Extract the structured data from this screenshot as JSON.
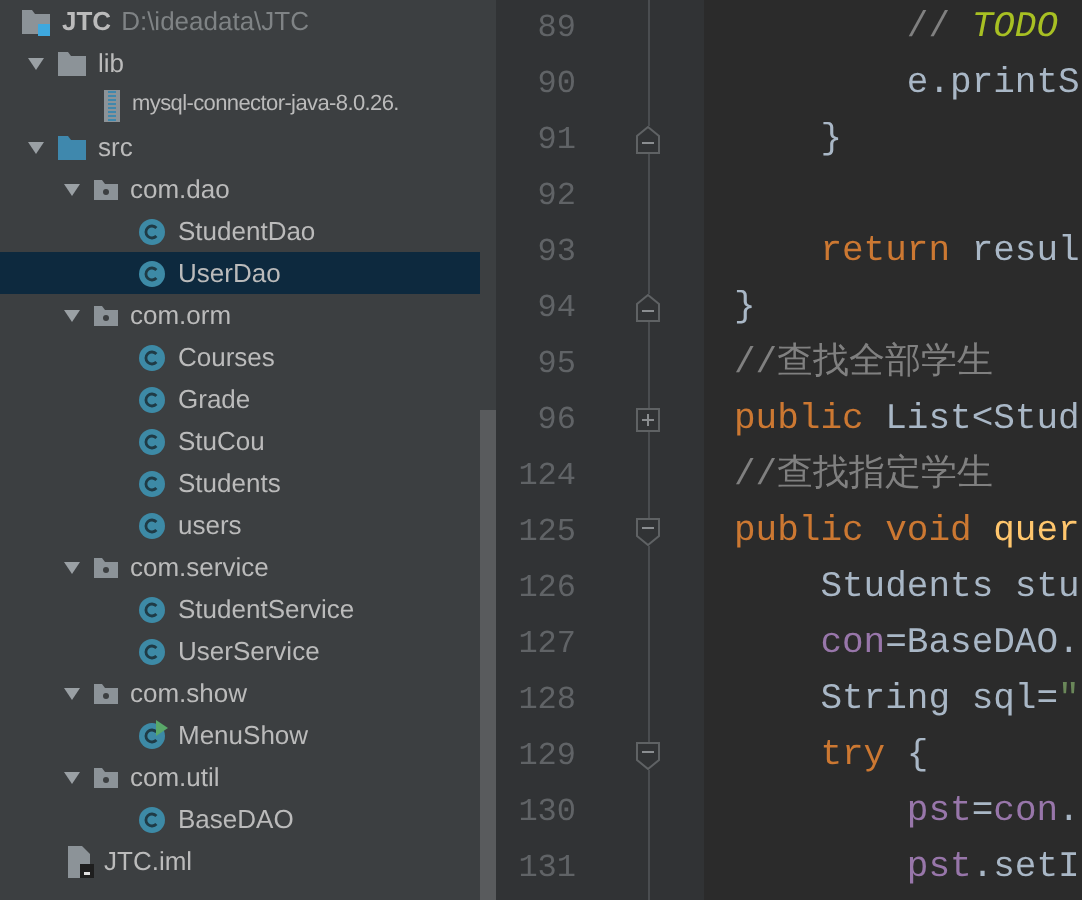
{
  "project_tree": [
    {
      "kind": "module",
      "label": "JTC",
      "path": "D:\\ideadata\\JTC",
      "selected": false,
      "children": [
        {
          "kind": "folder",
          "label": "lib",
          "expanded": true,
          "selected": false,
          "children": [
            {
              "kind": "jar",
              "label": "mysql-connector-java-8.0.26.",
              "selected": false
            }
          ]
        },
        {
          "kind": "source",
          "label": "src",
          "expanded": true,
          "selected": false,
          "children": [
            {
              "kind": "package",
              "label": "com.dao",
              "expanded": true,
              "selected": false,
              "children": [
                {
                  "kind": "class",
                  "label": "StudentDao",
                  "selected": false
                },
                {
                  "kind": "class",
                  "label": "UserDao",
                  "selected": true
                }
              ]
            },
            {
              "kind": "package",
              "label": "com.orm",
              "expanded": true,
              "selected": false,
              "children": [
                {
                  "kind": "class",
                  "label": "Courses",
                  "selected": false
                },
                {
                  "kind": "class",
                  "label": "Grade",
                  "selected": false
                },
                {
                  "kind": "class",
                  "label": "StuCou",
                  "selected": false
                },
                {
                  "kind": "class",
                  "label": "Students",
                  "selected": false
                },
                {
                  "kind": "class",
                  "label": "users",
                  "selected": false
                }
              ]
            },
            {
              "kind": "package",
              "label": "com.service",
              "expanded": true,
              "selected": false,
              "children": [
                {
                  "kind": "class",
                  "label": "StudentService",
                  "selected": false
                },
                {
                  "kind": "class",
                  "label": "UserService",
                  "selected": false
                }
              ]
            },
            {
              "kind": "package",
              "label": "com.show",
              "expanded": true,
              "selected": false,
              "children": [
                {
                  "kind": "runnable",
                  "label": "MenuShow",
                  "selected": false
                }
              ]
            },
            {
              "kind": "package",
              "label": "com.util",
              "expanded": true,
              "selected": false,
              "children": [
                {
                  "kind": "class",
                  "label": "BaseDAO",
                  "selected": false
                }
              ]
            }
          ]
        },
        {
          "kind": "file",
          "label": "JTC.iml",
          "selected": false
        }
      ]
    }
  ],
  "editor": {
    "lines": [
      {
        "number": "89",
        "kind": "plain",
        "tokens": [
          {
            "kind": "comment",
            "text": "        // "
          },
          {
            "kind": "todo",
            "text": "TODO"
          }
        ]
      },
      {
        "number": "90",
        "kind": "plain",
        "tokens": [
          {
            "kind": "plain",
            "text": "        e.printS"
          }
        ]
      },
      {
        "number": "91",
        "kind": "closer",
        "tokens": [
          {
            "kind": "plain",
            "text": "    }"
          }
        ]
      },
      {
        "number": "92",
        "kind": "plain"
      },
      {
        "number": "93",
        "kind": "plain",
        "tokens": [
          {
            "kind": "keyword",
            "text": "    return "
          },
          {
            "kind": "plain",
            "text": "resul"
          }
        ]
      },
      {
        "number": "94",
        "kind": "closer",
        "tokens": [
          {
            "kind": "plain",
            "text": "}"
          }
        ]
      },
      {
        "number": "95",
        "kind": "plain",
        "tokens": [
          {
            "kind": "comment",
            "text": "//查找全部学生"
          }
        ]
      },
      {
        "number": "96",
        "kind": "collapsed",
        "tokens": [
          {
            "kind": "keyword",
            "text": "public "
          },
          {
            "kind": "plain",
            "text": "List<Stud"
          }
        ]
      },
      {
        "number": "124",
        "kind": "plain",
        "tokens": [
          {
            "kind": "comment",
            "text": "//查找指定学生"
          }
        ]
      },
      {
        "number": "125",
        "kind": "opener",
        "tokens": [
          {
            "kind": "keyword",
            "text": "public void "
          },
          {
            "kind": "method",
            "text": "quer"
          }
        ]
      },
      {
        "number": "126",
        "kind": "plain",
        "tokens": [
          {
            "kind": "plain",
            "text": "    Students stu"
          }
        ]
      },
      {
        "number": "127",
        "kind": "plain",
        "tokens": [
          {
            "kind": "field",
            "text": "    con"
          },
          {
            "kind": "plain",
            "text": "=BaseDAO."
          }
        ]
      },
      {
        "number": "128",
        "kind": "plain",
        "tokens": [
          {
            "kind": "plain",
            "text": "    String sql="
          },
          {
            "kind": "string",
            "text": "\""
          }
        ]
      },
      {
        "number": "129",
        "kind": "opener",
        "tokens": [
          {
            "kind": "keyword",
            "text": "    try "
          },
          {
            "kind": "plain",
            "text": "{"
          }
        ]
      },
      {
        "number": "130",
        "kind": "plain",
        "tokens": [
          {
            "kind": "field",
            "text": "        pst"
          },
          {
            "kind": "plain",
            "text": "="
          },
          {
            "kind": "field",
            "text": "con"
          },
          {
            "kind": "plain",
            "text": "."
          }
        ]
      },
      {
        "number": "131",
        "kind": "plain",
        "tokens": [
          {
            "kind": "field",
            "text": "        pst"
          },
          {
            "kind": "plain",
            "text": ".setI"
          }
        ]
      }
    ]
  }
}
